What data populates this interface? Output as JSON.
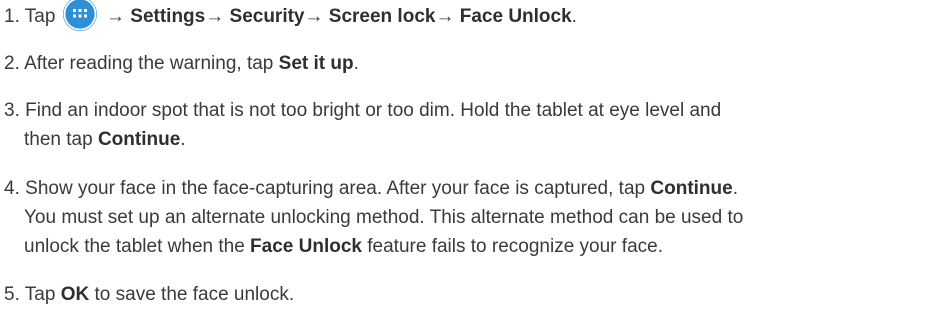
{
  "steps": [
    {
      "number": "1.",
      "parts": {
        "pre": "Tap",
        "settings": "Settings",
        "security": "Security",
        "screen_lock": "Screen lock",
        "face_unlock": "Face Unlock",
        "end": ".",
        "arrow": "→",
        "icon": "apps-icon"
      }
    },
    {
      "number": "2.",
      "parts": {
        "pre": "After reading the warning, tap ",
        "bold": "Set it up",
        "end": "."
      }
    },
    {
      "number": "3.",
      "line1": "Find an indoor spot that is not too bright or too dim. Hold the tablet at eye level and",
      "line2_pre": "then tap ",
      "line2_bold": "Continue",
      "line2_end": "."
    },
    {
      "number": "4.",
      "line1_pre": "Show your face in the face-capturing area. After your face is captured, tap ",
      "line1_bold": "Continue",
      "line1_end": ".",
      "line2": "You must set up an alternate unlocking method. This alternate method can be used to",
      "line3_pre": "unlock the tablet when the ",
      "line3_bold": "Face Unlock",
      "line3_end": " feature fails to recognize your face."
    },
    {
      "number": "5.",
      "parts": {
        "pre": "Tap ",
        "bold": "OK",
        "end": " to save the face unlock."
      }
    }
  ],
  "colors": {
    "text": "#3a3a3a",
    "icon_bg": "#2d8fd6",
    "icon_fg": "#ffffff"
  }
}
